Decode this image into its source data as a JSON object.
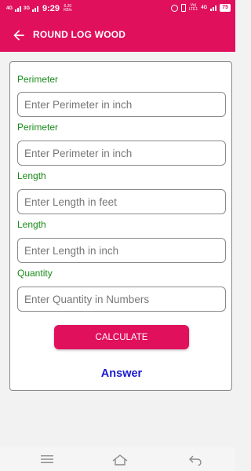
{
  "status_bar": {
    "sim1_network": "4G",
    "sim2_network": "3G",
    "time": "9:29",
    "data_speed_value": "6.20",
    "data_speed_unit": "KB/s",
    "volte_top": "Vo)",
    "volte_bottom": "LTE1",
    "network_right": "4G",
    "battery": "75"
  },
  "app_bar": {
    "title": "ROUND LOG WOOD",
    "back_icon": "arrow-left-icon"
  },
  "form": {
    "fields": [
      {
        "label": "Perimeter",
        "placeholder": "Enter Perimeter in inch",
        "value": ""
      },
      {
        "label": "Perimeter",
        "placeholder": "Enter Perimeter in inch",
        "value": ""
      },
      {
        "label": "Length",
        "placeholder": "Enter Length in feet",
        "value": ""
      },
      {
        "label": "Length",
        "placeholder": "Enter Length in inch",
        "value": ""
      },
      {
        "label": "Quantity",
        "placeholder": "Enter Quantity in Numbers",
        "value": ""
      }
    ],
    "calculate_label": "CALCULATE",
    "answer_label": "Answer"
  },
  "nav_bar": {
    "icons": [
      "menu-icon",
      "home-icon",
      "back-icon"
    ]
  },
  "colors": {
    "accent": "#e0105c",
    "label": "#1a8a1a",
    "answer": "#1a1ad0"
  }
}
